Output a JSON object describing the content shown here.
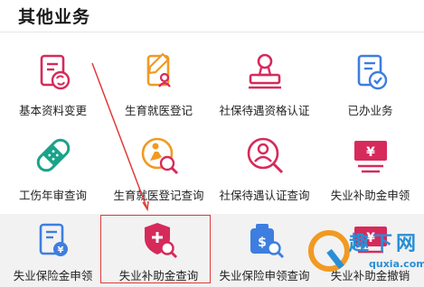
{
  "header": {
    "title": "其他业务"
  },
  "rows": [
    [
      {
        "label": "基本资料变更",
        "icon": "profile-change-icon"
      },
      {
        "label": "生育就医登记",
        "icon": "maternity-register-icon"
      },
      {
        "label": "社保待遇资格认证",
        "icon": "qualification-stamp-icon"
      },
      {
        "label": "已办业务",
        "icon": "done-business-icon"
      }
    ],
    [
      {
        "label": "工伤年审查询",
        "icon": "bandage-icon"
      },
      {
        "label": "生育就医登记查询",
        "icon": "maternity-query-icon"
      },
      {
        "label": "社保待遇认证查询",
        "icon": "face-auth-query-icon"
      },
      {
        "label": "失业补助金申领",
        "icon": "yuan-banner-icon"
      }
    ],
    [
      {
        "label": "失业保险金申领",
        "icon": "insurance-doc-icon"
      },
      {
        "label": "失业补助金查询",
        "icon": "shield-search-icon"
      },
      {
        "label": "失业保险申领查询",
        "icon": "money-bag-search-icon"
      },
      {
        "label": "失业补助金撤销",
        "icon": "yuan-banner-icon"
      }
    ]
  ],
  "watermark": {
    "text": "趣下网",
    "sub": "quxia.com"
  },
  "colors": {
    "accent": "#d62a5b",
    "highlight": "#e23a3a",
    "icon_blue": "#3d7ee0"
  }
}
